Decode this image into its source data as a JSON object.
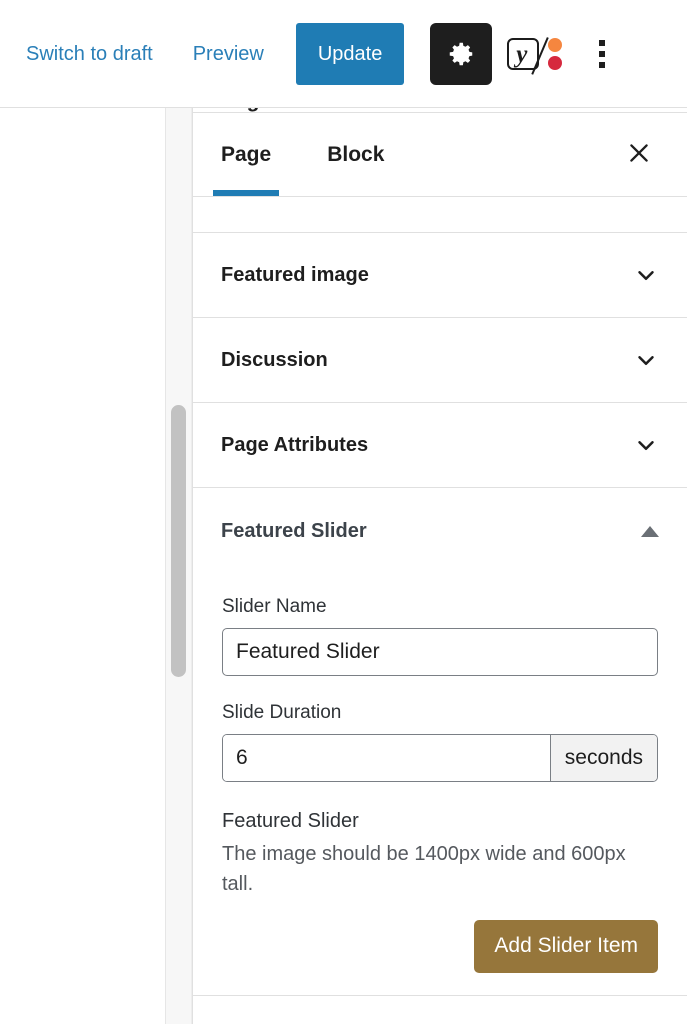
{
  "toolbar": {
    "switch_to_draft": "Switch to draft",
    "preview": "Preview",
    "update": "Update",
    "settings_icon": "gear-icon",
    "yoast_icon": "yoast-seo-icon",
    "options_icon": "kebab-menu-icon",
    "update_bg": "#1f7cb4",
    "link_color": "#2a7fb8",
    "settings_bg": "#1e1e1e"
  },
  "sidebar": {
    "cut_off_title": "Page",
    "tabs": [
      {
        "label": "Page",
        "active": true
      },
      {
        "label": "Block",
        "active": false
      }
    ],
    "close_label": "Close settings",
    "accent": "#1f7cb4",
    "panels": [
      {
        "label": "Featured image",
        "state": "collapsed",
        "icon": "chevron-down-icon"
      },
      {
        "label": "Discussion",
        "state": "collapsed",
        "icon": "chevron-down-icon"
      },
      {
        "label": "Page Attributes",
        "state": "collapsed",
        "icon": "chevron-down-icon"
      }
    ],
    "featured_slider": {
      "title": "Featured Slider",
      "toggle_icon": "triangle-up-icon",
      "state": "expanded",
      "slider_name": {
        "label": "Slider Name",
        "value": "Featured Slider",
        "placeholder": "Slider Name"
      },
      "slide_duration": {
        "label": "Slide Duration",
        "value": "6",
        "placeholder": "6",
        "unit": "seconds"
      },
      "media": {
        "title": "Featured Slider",
        "help": "The image should be 1400px wide and 600px tall.",
        "add_button": "Add Slider Item",
        "add_button_bg": "#96763b"
      }
    }
  },
  "scrollbar": {
    "name": "sidebar-scrollbar"
  }
}
